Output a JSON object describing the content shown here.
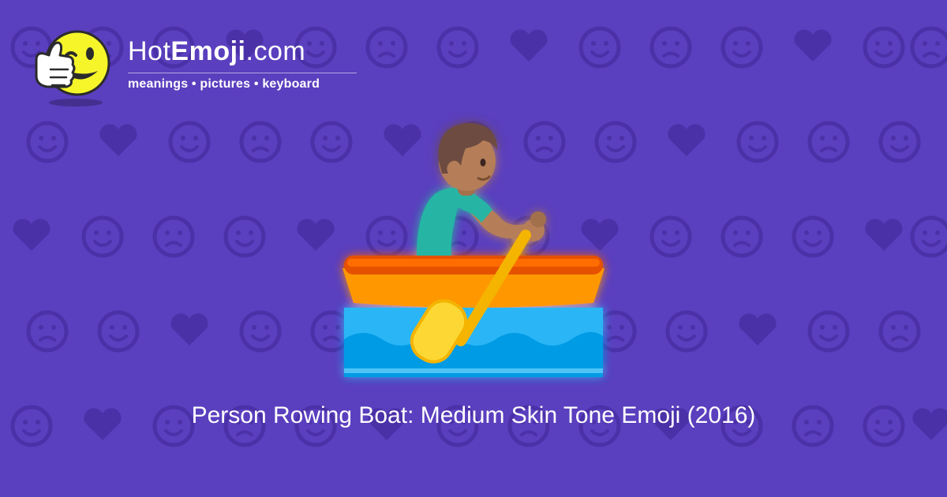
{
  "colors": {
    "background": "#5a3fbe",
    "pattern": "#4b31a8",
    "text": "#ffffff"
  },
  "logo": {
    "title_prefix": "Hot",
    "title_bold": "Emoji",
    "title_suffix": ".com",
    "tagline": "meanings • pictures • keyboard",
    "mascot_icon": "winking-thumbs-up-face-icon"
  },
  "hero": {
    "icon": "person-rowing-boat-medium-skin-tone-icon"
  },
  "caption": "Person Rowing Boat: Medium Skin Tone Emoji (2016)"
}
